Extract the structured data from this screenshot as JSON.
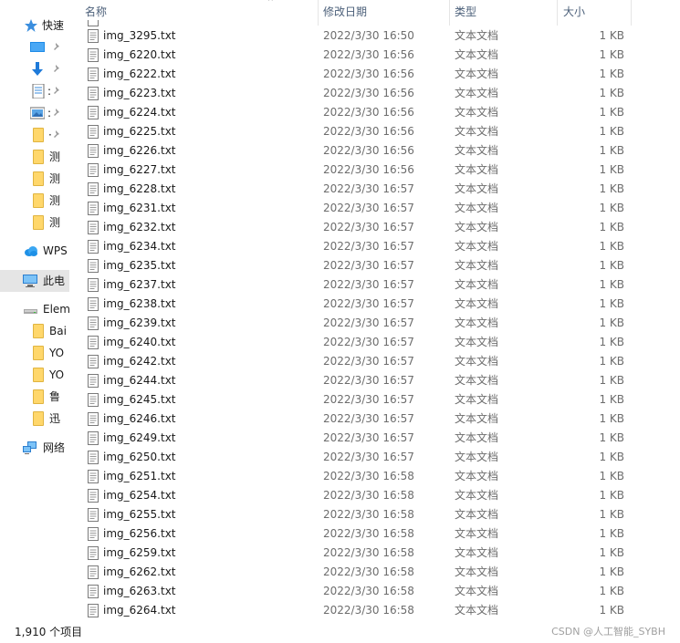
{
  "sidebar": {
    "items": [
      {
        "label": "快速",
        "icon": "star-icon"
      },
      {
        "label": "",
        "icon": "desktop-icon"
      },
      {
        "label": "",
        "icon": "downloads-icon"
      },
      {
        "label": ":",
        "icon": "document-icon"
      },
      {
        "label": ":",
        "icon": "pictures-icon"
      },
      {
        "label": "·",
        "icon": "folder-icon"
      },
      {
        "label": "测",
        "icon": "folder-icon"
      },
      {
        "label": "测",
        "icon": "folder-icon"
      },
      {
        "label": "测",
        "icon": "folder-icon"
      },
      {
        "label": "测",
        "icon": "folder-icon"
      },
      {
        "label": "WPS",
        "icon": "cloud-icon"
      },
      {
        "label": "此电",
        "icon": "computer-icon"
      },
      {
        "label": "Elem",
        "icon": "drive-icon"
      },
      {
        "label": "Bai",
        "icon": "folder-icon"
      },
      {
        "label": "YO",
        "icon": "folder-icon"
      },
      {
        "label": "YO",
        "icon": "folder-icon"
      },
      {
        "label": "鲁",
        "icon": "folder-icon"
      },
      {
        "label": "迅",
        "icon": "folder-icon"
      },
      {
        "label": "网络",
        "icon": "network-icon"
      }
    ]
  },
  "columns": {
    "name": "名称",
    "date": "修改日期",
    "type": "类型",
    "size": "大小"
  },
  "files": [
    {
      "name": "img_3295.txt",
      "date": "2022/3/30 16:50",
      "type": "文本文档",
      "size": "1 KB"
    },
    {
      "name": "img_6220.txt",
      "date": "2022/3/30 16:56",
      "type": "文本文档",
      "size": "1 KB"
    },
    {
      "name": "img_6222.txt",
      "date": "2022/3/30 16:56",
      "type": "文本文档",
      "size": "1 KB"
    },
    {
      "name": "img_6223.txt",
      "date": "2022/3/30 16:56",
      "type": "文本文档",
      "size": "1 KB"
    },
    {
      "name": "img_6224.txt",
      "date": "2022/3/30 16:56",
      "type": "文本文档",
      "size": "1 KB"
    },
    {
      "name": "img_6225.txt",
      "date": "2022/3/30 16:56",
      "type": "文本文档",
      "size": "1 KB"
    },
    {
      "name": "img_6226.txt",
      "date": "2022/3/30 16:56",
      "type": "文本文档",
      "size": "1 KB"
    },
    {
      "name": "img_6227.txt",
      "date": "2022/3/30 16:56",
      "type": "文本文档",
      "size": "1 KB"
    },
    {
      "name": "img_6228.txt",
      "date": "2022/3/30 16:57",
      "type": "文本文档",
      "size": "1 KB"
    },
    {
      "name": "img_6231.txt",
      "date": "2022/3/30 16:57",
      "type": "文本文档",
      "size": "1 KB"
    },
    {
      "name": "img_6232.txt",
      "date": "2022/3/30 16:57",
      "type": "文本文档",
      "size": "1 KB"
    },
    {
      "name": "img_6234.txt",
      "date": "2022/3/30 16:57",
      "type": "文本文档",
      "size": "1 KB"
    },
    {
      "name": "img_6235.txt",
      "date": "2022/3/30 16:57",
      "type": "文本文档",
      "size": "1 KB"
    },
    {
      "name": "img_6237.txt",
      "date": "2022/3/30 16:57",
      "type": "文本文档",
      "size": "1 KB"
    },
    {
      "name": "img_6238.txt",
      "date": "2022/3/30 16:57",
      "type": "文本文档",
      "size": "1 KB"
    },
    {
      "name": "img_6239.txt",
      "date": "2022/3/30 16:57",
      "type": "文本文档",
      "size": "1 KB"
    },
    {
      "name": "img_6240.txt",
      "date": "2022/3/30 16:57",
      "type": "文本文档",
      "size": "1 KB"
    },
    {
      "name": "img_6242.txt",
      "date": "2022/3/30 16:57",
      "type": "文本文档",
      "size": "1 KB"
    },
    {
      "name": "img_6244.txt",
      "date": "2022/3/30 16:57",
      "type": "文本文档",
      "size": "1 KB"
    },
    {
      "name": "img_6245.txt",
      "date": "2022/3/30 16:57",
      "type": "文本文档",
      "size": "1 KB"
    },
    {
      "name": "img_6246.txt",
      "date": "2022/3/30 16:57",
      "type": "文本文档",
      "size": "1 KB"
    },
    {
      "name": "img_6249.txt",
      "date": "2022/3/30 16:57",
      "type": "文本文档",
      "size": "1 KB"
    },
    {
      "name": "img_6250.txt",
      "date": "2022/3/30 16:57",
      "type": "文本文档",
      "size": "1 KB"
    },
    {
      "name": "img_6251.txt",
      "date": "2022/3/30 16:58",
      "type": "文本文档",
      "size": "1 KB"
    },
    {
      "name": "img_6254.txt",
      "date": "2022/3/30 16:58",
      "type": "文本文档",
      "size": "1 KB"
    },
    {
      "name": "img_6255.txt",
      "date": "2022/3/30 16:58",
      "type": "文本文档",
      "size": "1 KB"
    },
    {
      "name": "img_6256.txt",
      "date": "2022/3/30 16:58",
      "type": "文本文档",
      "size": "1 KB"
    },
    {
      "name": "img_6259.txt",
      "date": "2022/3/30 16:58",
      "type": "文本文档",
      "size": "1 KB"
    },
    {
      "name": "img_6262.txt",
      "date": "2022/3/30 16:58",
      "type": "文本文档",
      "size": "1 KB"
    },
    {
      "name": "img_6263.txt",
      "date": "2022/3/30 16:58",
      "type": "文本文档",
      "size": "1 KB"
    },
    {
      "name": "img_6264.txt",
      "date": "2022/3/30 16:58",
      "type": "文本文档",
      "size": "1 KB"
    }
  ],
  "status": {
    "item_count": "1,910 个项目"
  },
  "watermark": "CSDN @人工智能_SYBH"
}
